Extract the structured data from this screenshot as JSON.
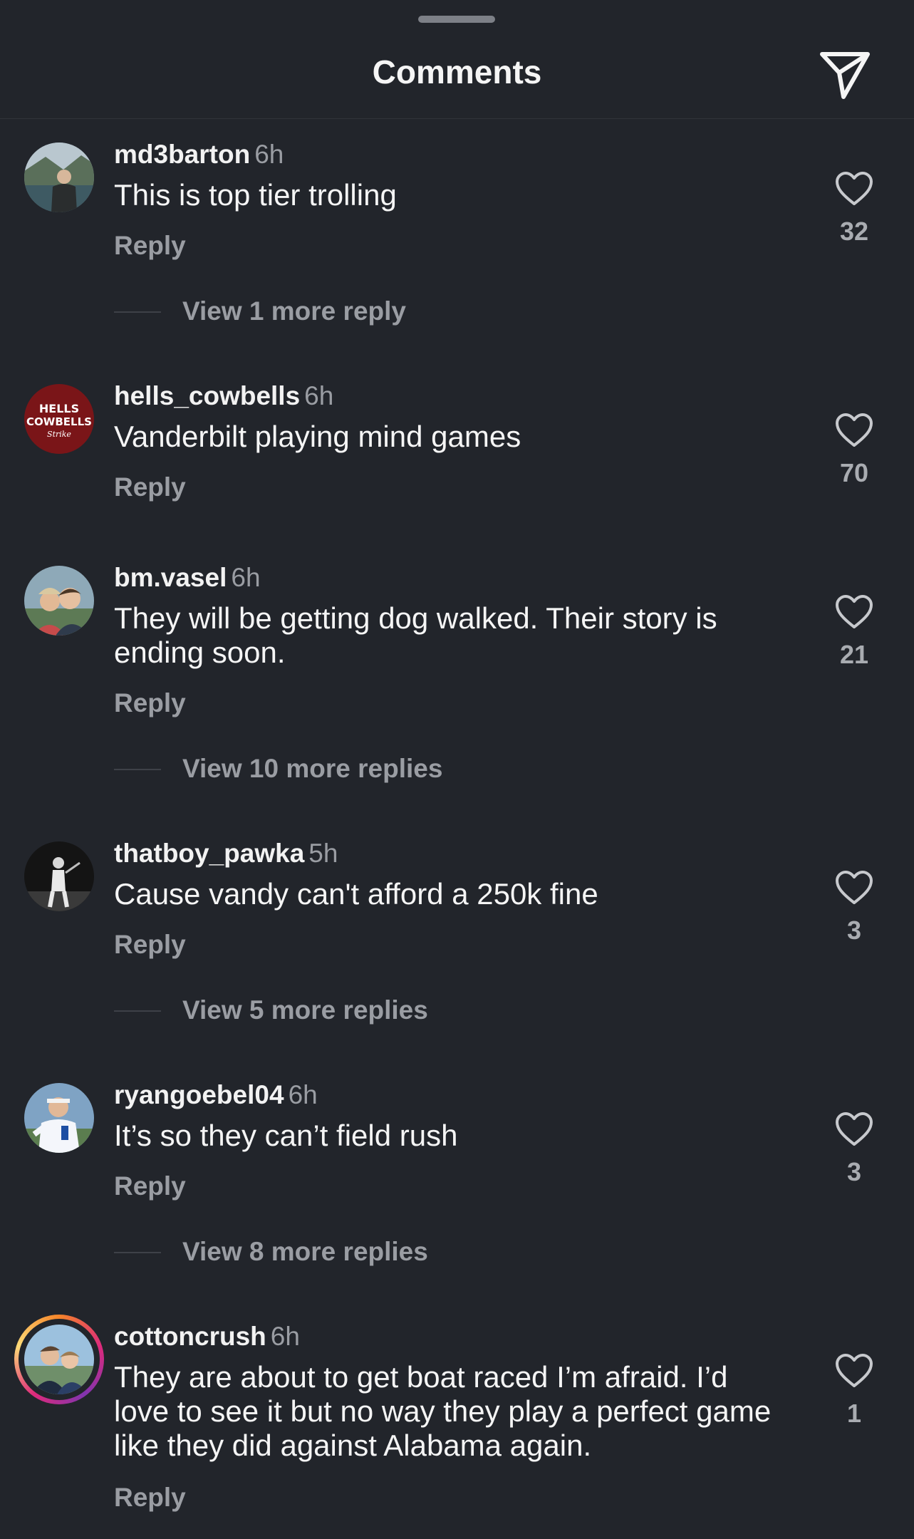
{
  "header": {
    "title": "Comments",
    "send_icon": "paper-plane-icon"
  },
  "colors": {
    "background": "#22252b",
    "text_primary": "#f5f5f5",
    "text_secondary": "#9a9da3",
    "story_ring": "#dd2a7b"
  },
  "comments": [
    {
      "username": "md3barton",
      "time": "6h",
      "text": "This is top tier trolling",
      "reply_label": "Reply",
      "likes": "32",
      "view_more": "View 1 more reply"
    },
    {
      "username": "hells_cowbells",
      "time": "6h",
      "text": "Vanderbilt playing mind games",
      "reply_label": "Reply",
      "likes": "70",
      "avatar_logo": {
        "line1": "HELLS",
        "line2": "COWBELLS",
        "line3": "Strike"
      }
    },
    {
      "username": "bm.vasel",
      "time": "6h",
      "text": "They will be getting dog walked.  Their story is ending soon.",
      "reply_label": "Reply",
      "likes": "21",
      "view_more": "View 10 more replies"
    },
    {
      "username": "thatboy_pawka",
      "time": "5h",
      "text": "Cause vandy can't afford a 250k fine",
      "reply_label": "Reply",
      "likes": "3",
      "view_more": "View 5 more replies"
    },
    {
      "username": "ryangoebel04",
      "time": "6h",
      "text": "It’s so they can’t field rush",
      "reply_label": "Reply",
      "likes": "3",
      "view_more": "View 8 more replies"
    },
    {
      "username": "cottoncrush",
      "time": "6h",
      "text": "They are about to get boat raced I’m afraid. I’d love to see it but no way they play a perfect game like they did against Alabama again.",
      "reply_label": "Reply",
      "likes": "1"
    }
  ]
}
